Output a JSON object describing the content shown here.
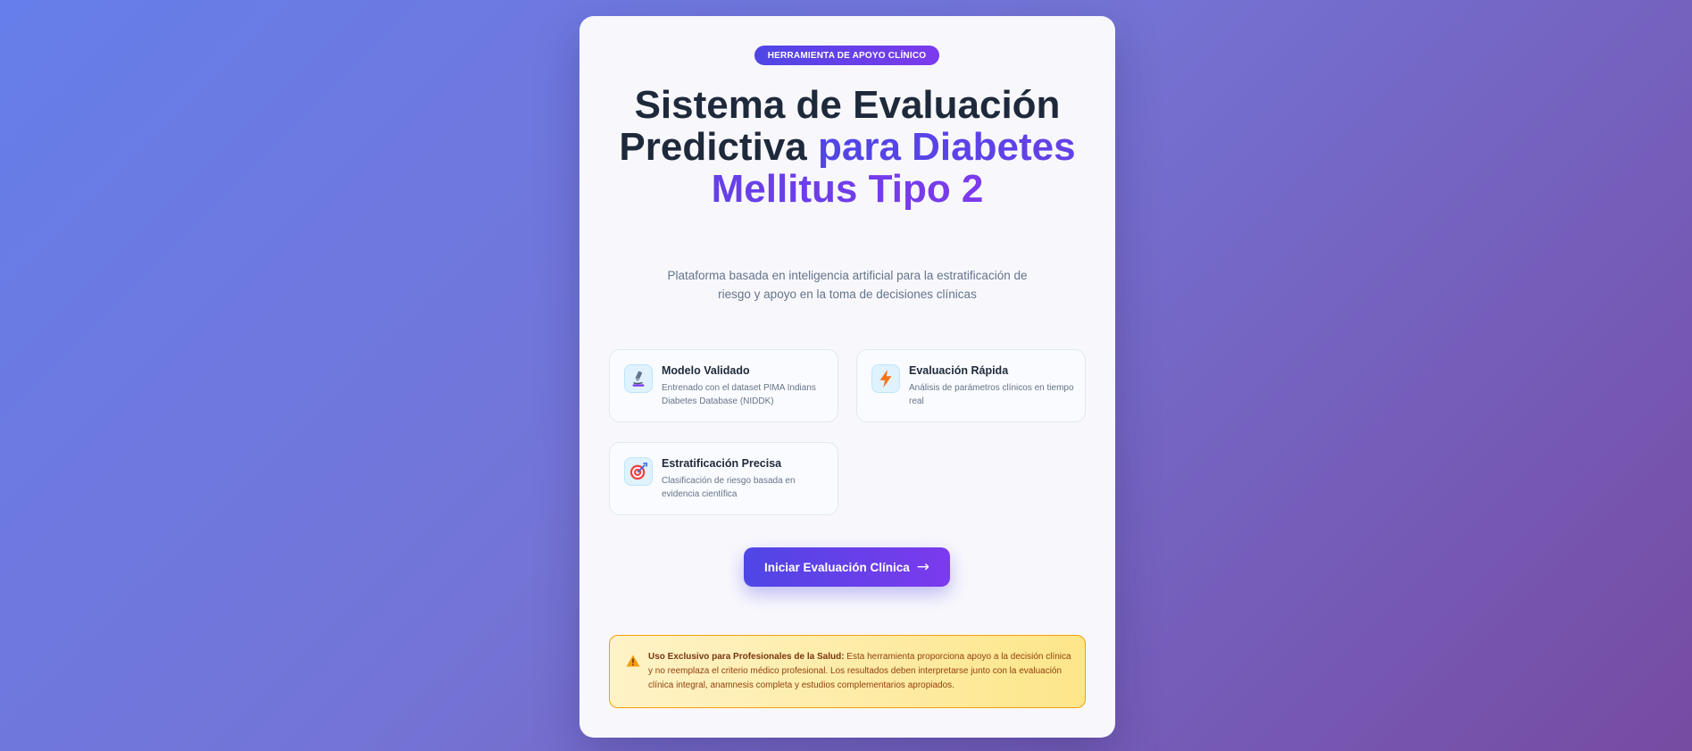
{
  "badge": "HERRAMIENTA DE APOYO CLÍNICO",
  "title": {
    "part1": "Sistema de Evaluación Predictiva ",
    "part2": "para Diabetes Mellitus Tipo 2"
  },
  "subtitle": "Plataforma basada en inteligencia artificial para la estratificación de riesgo y apoyo en la toma de decisiones clínicas",
  "features": [
    {
      "icon": "microscope-icon",
      "title": "Modelo Validado",
      "description": "Entrenado con el dataset PIMA Indians Diabetes Database (NIDDK)"
    },
    {
      "icon": "lightning-icon",
      "title": "Evaluación Rápida",
      "description": "Análisis de parámetros clínicos en tiempo real"
    },
    {
      "icon": "target-icon",
      "title": "Estratificación Precisa",
      "description": "Clasificación de riesgo basada en evidencia científica"
    }
  ],
  "cta": {
    "label": "Iniciar Evaluación Clínica",
    "arrow": "→"
  },
  "warning": {
    "icon": "warning-icon",
    "heading": "Uso Exclusivo para Profesionales de la Salud:",
    "body": " Esta herramienta proporciona apoyo a la decisión clínica y no reemplaza el criterio médico profesional. Los resultados deben interpretarse junto con la evaluación clínica integral, anamnesis completa y estudios complementarios apropiados."
  },
  "colors": {
    "accent_start": "#4f46e5",
    "accent_end": "#7c3aed",
    "background_start": "#667eea",
    "background_end": "#764ba2",
    "warning_bg": "#fef3c7",
    "warning_border": "#f59e0b"
  }
}
